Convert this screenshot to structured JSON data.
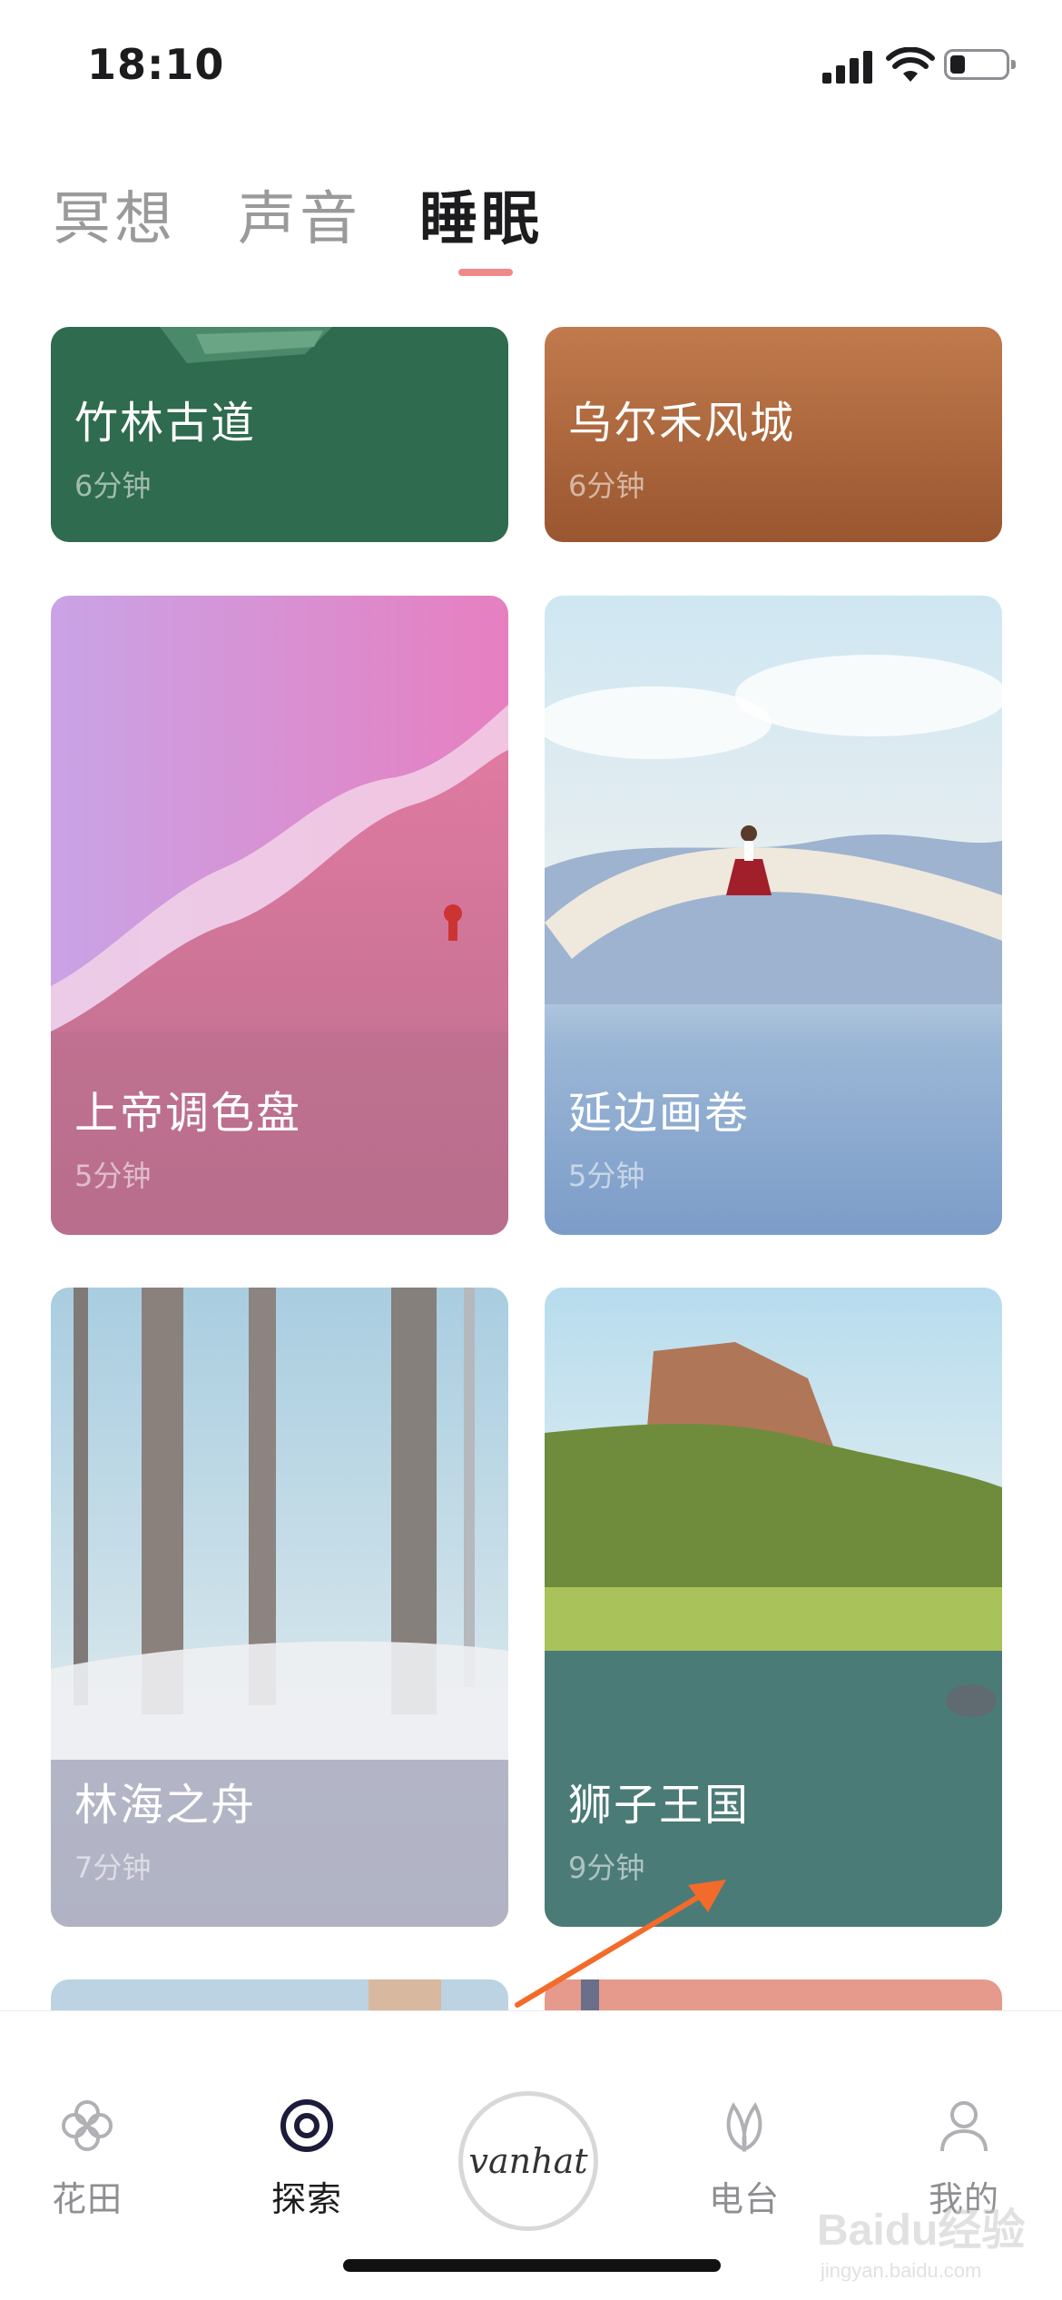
{
  "status_bar": {
    "time": "18:10"
  },
  "tabs": [
    {
      "label": "冥想",
      "active": false
    },
    {
      "label": "声音",
      "active": false
    },
    {
      "label": "睡眠",
      "active": true
    }
  ],
  "cards": [
    {
      "title": "竹林古道",
      "duration": "6分钟"
    },
    {
      "title": "乌尔禾风城",
      "duration": "6分钟"
    },
    {
      "title": "上帝调色盘",
      "duration": "5分钟"
    },
    {
      "title": "延边画卷",
      "duration": "5分钟"
    },
    {
      "title": "林海之舟",
      "duration": "7分钟"
    },
    {
      "title": "狮子王国",
      "duration": "9分钟"
    }
  ],
  "bottom_nav": {
    "items": [
      {
        "label": "花田",
        "icon": "flower-icon",
        "active": false
      },
      {
        "label": "探索",
        "icon": "target-icon",
        "active": true
      },
      {
        "label": "电台",
        "icon": "leaf-icon",
        "active": false
      },
      {
        "label": "我的",
        "icon": "person-icon",
        "active": false
      }
    ],
    "center_label": "vanhat"
  },
  "watermark": {
    "text": "Baidu经验",
    "subtext": "jingyan.baidu.com"
  },
  "colors": {
    "tab_indicator": "#f08a8a",
    "annotation_arrow": "#f26b2a"
  }
}
